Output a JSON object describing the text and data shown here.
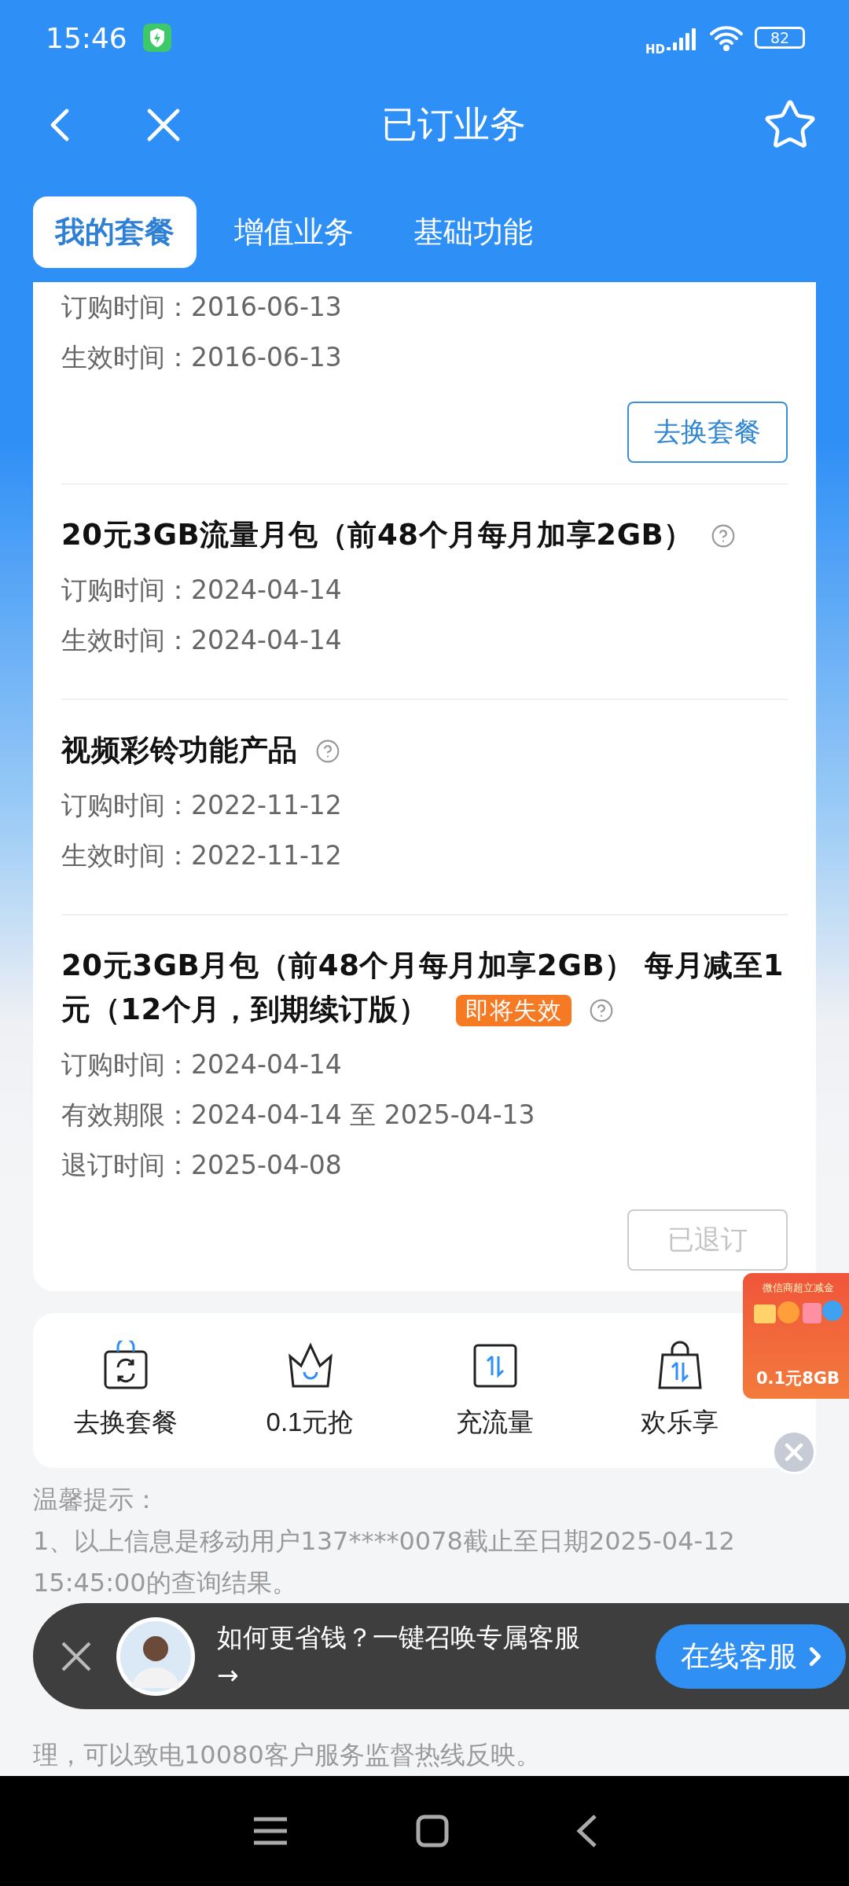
{
  "status_bar": {
    "time": "15:46",
    "network": "HD",
    "battery": "82"
  },
  "header": {
    "title": "已订业务"
  },
  "tabs": [
    {
      "label": "我的套餐",
      "selected": true
    },
    {
      "label": "增值业务",
      "selected": false
    },
    {
      "label": "基础功能",
      "selected": false
    }
  ],
  "plans": [
    {
      "fields": [
        {
          "label": "订购时间：",
          "value": "2016-06-13"
        },
        {
          "label": "生效时间：",
          "value": "2016-06-13"
        }
      ],
      "button": {
        "label": "去换套餐",
        "disabled": false
      }
    },
    {
      "title": "20元3GB流量月包（前48个月每月加享2GB）",
      "help": true,
      "fields": [
        {
          "label": "订购时间：",
          "value": "2024-04-14"
        },
        {
          "label": "生效时间：",
          "value": "2024-04-14"
        }
      ]
    },
    {
      "title": "视频彩铃功能产品",
      "help": true,
      "fields": [
        {
          "label": "订购时间：",
          "value": "2022-11-12"
        },
        {
          "label": "生效时间：",
          "value": "2022-11-12"
        }
      ]
    },
    {
      "title": "20元3GB月包（前48个月每月加享2GB） 每月减至1元（12个月，到期续订版）",
      "badge": "即将失效",
      "help": true,
      "fields": [
        {
          "label": "订购时间：",
          "value": "2024-04-14"
        },
        {
          "label": "有效期限：",
          "value": "2024-04-14 至 2025-04-13"
        },
        {
          "label": "退订时间：",
          "value": "2025-04-08"
        }
      ],
      "button": {
        "label": "已退订",
        "disabled": true
      }
    }
  ],
  "shortcuts": [
    {
      "kind": "swap",
      "label": "去换套餐"
    },
    {
      "kind": "crown",
      "label": "0.1元抢"
    },
    {
      "kind": "traffic",
      "label": "充流量"
    },
    {
      "kind": "bag",
      "label": "欢乐享"
    }
  ],
  "promo": {
    "caption": "微信商超立减金",
    "price": "0.1元8GB"
  },
  "tips": {
    "title": "温馨提示：",
    "lines": [
      "1、以上信息是移动用户137****0078截止至日期2025-04-12 15:45:00的查询结果。",
      "理，可以致电10080客户服务监督热线反映。"
    ]
  },
  "chat_banner": {
    "text": "如何更省钱？一键召唤专属客服",
    "arrow": "→",
    "button": "在线客服"
  }
}
